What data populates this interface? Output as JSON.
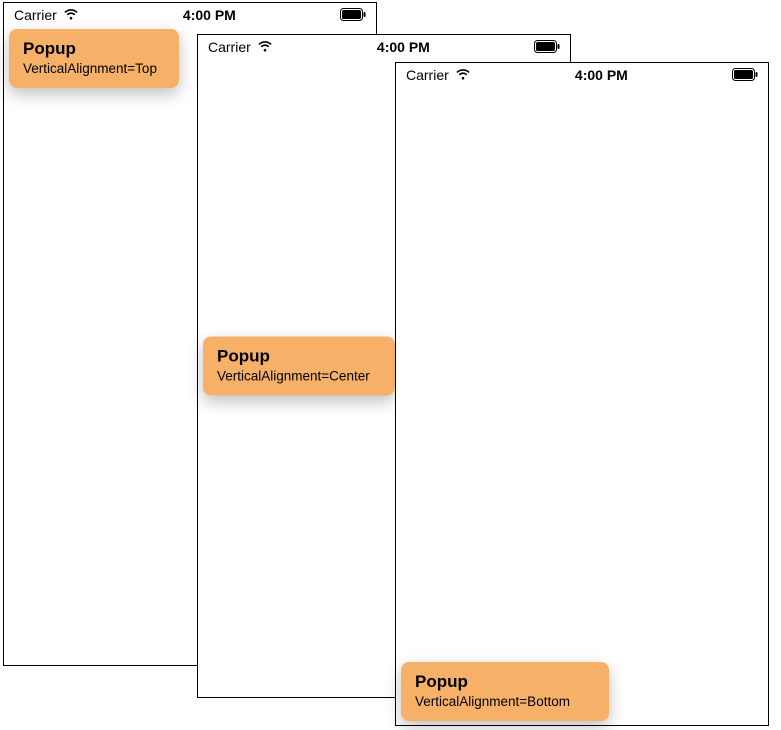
{
  "status": {
    "carrier": "Carrier",
    "time": "4:00 PM"
  },
  "popups": {
    "top": {
      "title": "Popup",
      "desc": "VerticalAlignment=Top"
    },
    "center": {
      "title": "Popup",
      "desc": "VerticalAlignment=Center"
    },
    "bottom": {
      "title": "Popup",
      "desc": "VerticalAlignment=Bottom"
    }
  }
}
